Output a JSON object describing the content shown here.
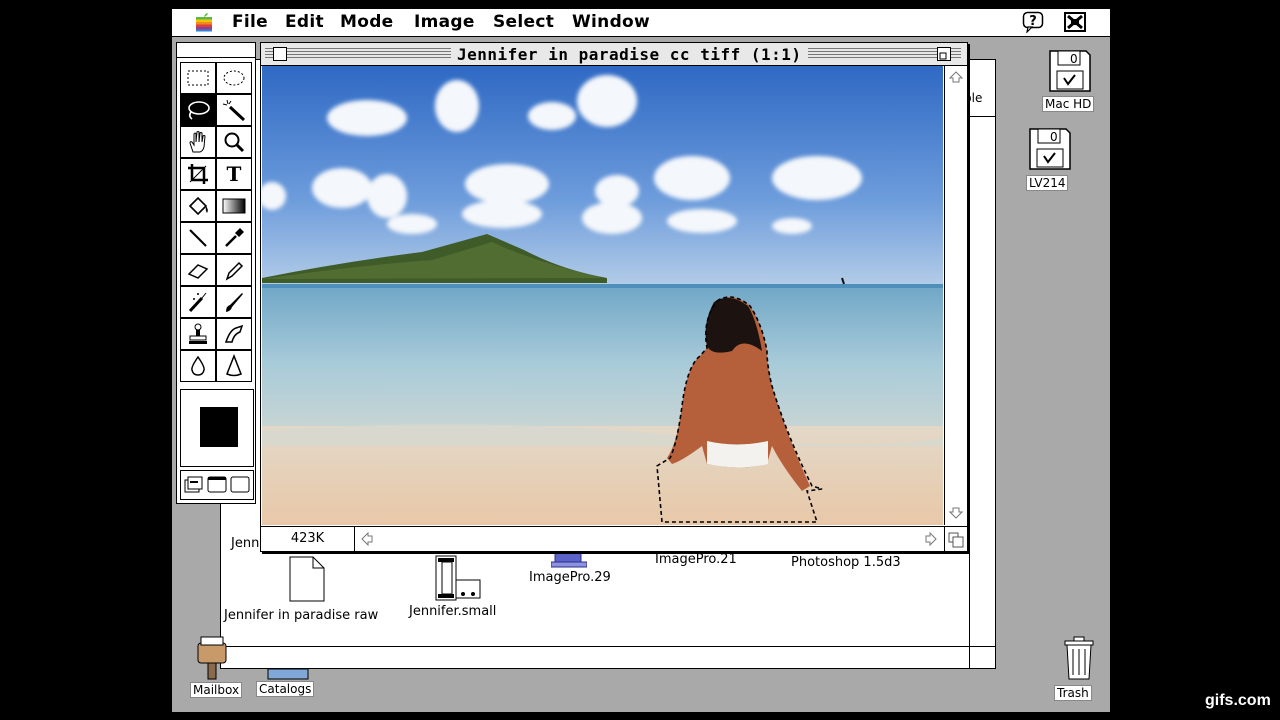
{
  "menubar": {
    "items": [
      "File",
      "Edit",
      "Mode",
      "Image",
      "Select",
      "Window"
    ]
  },
  "document": {
    "title": "Jennifer in paradise cc tiff  (1:1)",
    "size_readout": "423K"
  },
  "finder": {
    "partial_label": "Jenn",
    "side_label": "ble",
    "files": [
      {
        "label": "Jennifer in paradise raw"
      },
      {
        "label": "Jennifer.small"
      },
      {
        "label": "ImagePro.29"
      },
      {
        "label": "ImagePro.21"
      },
      {
        "label": "Photoshop 1.5d3"
      }
    ]
  },
  "desktop": {
    "disks": [
      {
        "label": "Mac HD",
        "badge": "0"
      },
      {
        "label": "LV214",
        "badge": "0"
      }
    ],
    "mailbox": "Mailbox",
    "catalogs": "Catalogs",
    "trash": "Trash"
  },
  "toolbox": {
    "tools": [
      "rect-marquee",
      "ellipse-marquee",
      "lasso",
      "magic-wand",
      "hand",
      "zoom",
      "crop",
      "type",
      "paint-bucket",
      "gradient",
      "line",
      "eyedropper",
      "eraser",
      "pencil",
      "airbrush",
      "paintbrush",
      "rubber-stamp",
      "smudge",
      "blur",
      "sharpen"
    ],
    "selected_tool": "lasso",
    "foreground_color": "#000000"
  },
  "watermark": "gifs.com"
}
